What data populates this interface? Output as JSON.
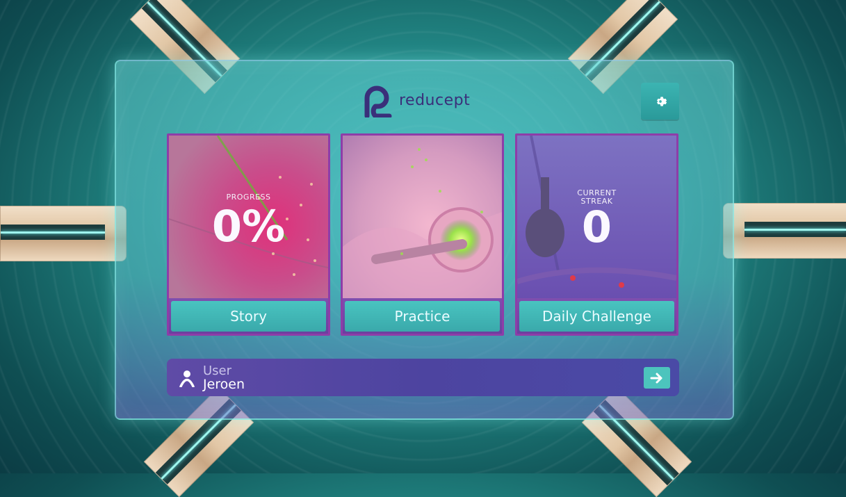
{
  "brand": {
    "name": "reducept"
  },
  "settings": {
    "icon": "gear-icon"
  },
  "cards": [
    {
      "id": "story",
      "label": "Story",
      "overlay_caption": "PROGRESS",
      "overlay_value": "0%"
    },
    {
      "id": "practice",
      "label": "Practice"
    },
    {
      "id": "daily",
      "label": "Daily Challenge",
      "overlay_caption_line1": "CURRENT",
      "overlay_caption_line2": "STREAK",
      "overlay_value": "0"
    }
  ],
  "user": {
    "label": "User",
    "name": "Jeroen",
    "icon": "user-icon",
    "action_icon": "arrow-right-icon"
  },
  "colors": {
    "card_border": "#8e3da8",
    "button": "#3aa9ab",
    "logo": "#3a2f7a",
    "userbar": "#5247a2"
  }
}
